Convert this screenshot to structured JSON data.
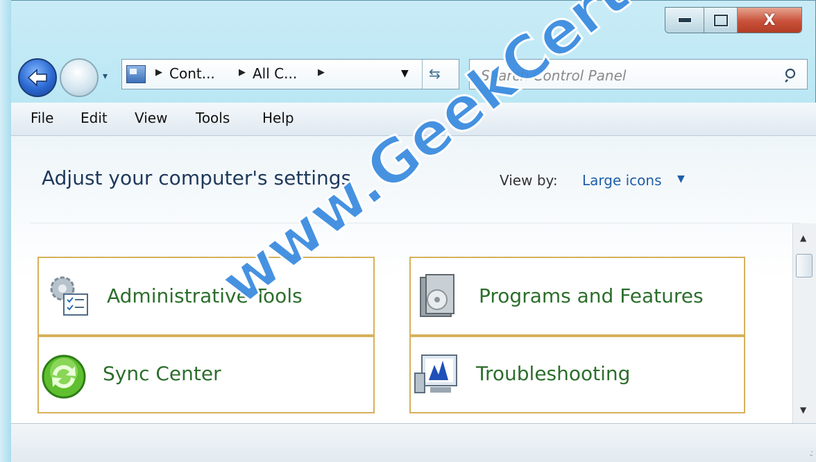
{
  "window": {
    "caption_buttons": {
      "close_glyph": "X"
    }
  },
  "nav": {
    "breadcrumbs": [
      "Cont...",
      "All C..."
    ],
    "search_placeholder": "Search Control Panel"
  },
  "menu": [
    "File",
    "Edit",
    "View",
    "Tools",
    "Help"
  ],
  "content": {
    "heading": "Adjust your computer's settings",
    "view_by_label": "View by:",
    "view_by_value": "Large icons",
    "items": [
      {
        "label": "Administrative Tools",
        "icon": "admin-tools-icon"
      },
      {
        "label": "Programs and Features",
        "icon": "programs-features-icon"
      },
      {
        "label": "Sync Center",
        "icon": "sync-center-icon"
      },
      {
        "label": "Troubleshooting",
        "icon": "troubleshooting-icon"
      }
    ]
  },
  "watermark": "www.GeekCert.com",
  "colors": {
    "tile_border": "#d6b15a",
    "item_label": "#2c6e2c",
    "heading": "#1e395b",
    "link": "#1f5fa8"
  }
}
